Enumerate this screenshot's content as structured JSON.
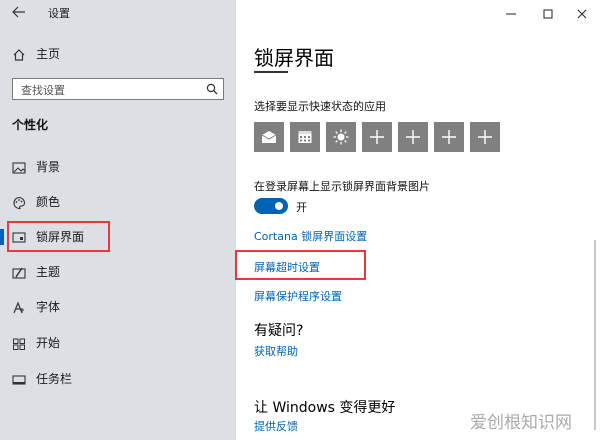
{
  "window": {
    "title": "设置"
  },
  "sidebar": {
    "home": "主页",
    "search_placeholder": "查找设置",
    "section": "个性化",
    "items": [
      {
        "label": "背景"
      },
      {
        "label": "颜色"
      },
      {
        "label": "锁屏界面"
      },
      {
        "label": "主题"
      },
      {
        "label": "字体"
      },
      {
        "label": "开始"
      },
      {
        "label": "任务栏"
      }
    ]
  },
  "main": {
    "title": "锁屏界面",
    "quick_status_label": "选择要显示快速状态的应用",
    "quick_status_apps": [
      "mail-icon",
      "calendar-icon",
      "weather-icon",
      "plus-icon",
      "plus-icon",
      "plus-icon",
      "plus-icon"
    ],
    "bg_toggle_label": "在登录屏幕上显示锁屏界面背景图片",
    "toggle_state": "开",
    "toggle_on": true,
    "links": {
      "cortana": "Cortana 锁屏界面设置",
      "timeout": "屏幕超时设置",
      "screensaver": "屏幕保护程序设置"
    },
    "question_heading": "有疑问?",
    "get_help": "获取帮助",
    "better_heading": "让 Windows 变得更好",
    "feedback": "提供反馈"
  },
  "watermark": "爱创根知识网",
  "colors": {
    "accent": "#0063b1",
    "highlight": "#e8383d",
    "tile": "#808080"
  }
}
